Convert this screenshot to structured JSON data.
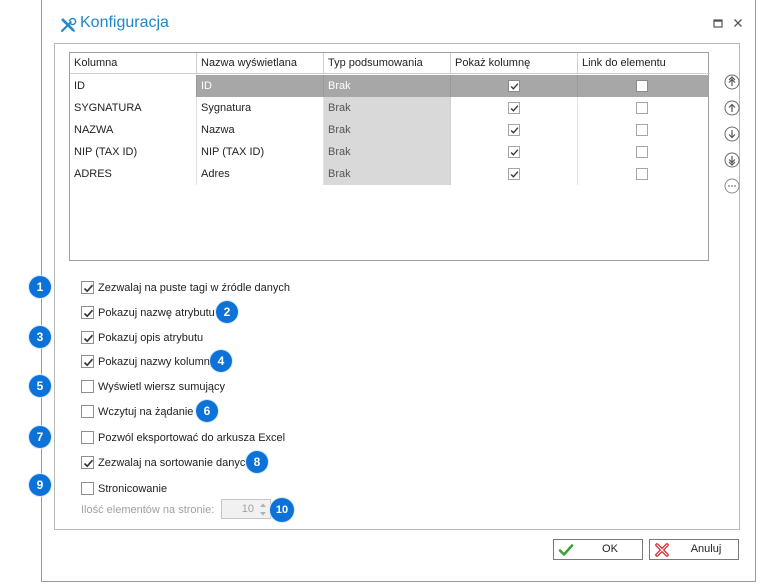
{
  "window": {
    "title": "Konfiguracja"
  },
  "grid": {
    "headers": [
      "Kolumna",
      "Nazwa wyświetlana",
      "Typ podsumowania",
      "Pokaż kolumnę",
      "Link do elementu"
    ],
    "rows": [
      {
        "kolumna": "ID",
        "nazwa": "ID",
        "typ": "Brak",
        "pokaz": true,
        "link": false
      },
      {
        "kolumna": "SYGNATURA",
        "nazwa": "Sygnatura",
        "typ": "Brak",
        "pokaz": true,
        "link": false
      },
      {
        "kolumna": "NAZWA",
        "nazwa": "Nazwa",
        "typ": "Brak",
        "pokaz": true,
        "link": false
      },
      {
        "kolumna": "NIP (TAX ID)",
        "nazwa": "NIP (TAX ID)",
        "typ": "Brak",
        "pokaz": true,
        "link": false
      },
      {
        "kolumna": "ADRES",
        "nazwa": "Adres",
        "typ": "Brak",
        "pokaz": true,
        "link": false
      }
    ]
  },
  "side_buttons": [
    "move-top-icon",
    "move-up-icon",
    "move-down-icon",
    "move-bottom-icon",
    "more-icon"
  ],
  "options": [
    {
      "label": "Zezwalaj na puste tagi w źródle danych",
      "checked": true,
      "badge": "1"
    },
    {
      "label": "Pokazuj nazwę atrybutu",
      "checked": true,
      "badge": "2"
    },
    {
      "label": "Pokazuj opis atrybutu",
      "checked": true,
      "badge": "3"
    },
    {
      "label": "Pokazuj nazwy kolumn",
      "checked": true,
      "badge": "4"
    },
    {
      "label": "Wyświetl wiersz sumujący",
      "checked": false,
      "badge": "5"
    },
    {
      "label": "Wczytuj na żądanie",
      "checked": false,
      "badge": "6"
    },
    {
      "label": "Pozwól eksportować do arkusza Excel",
      "checked": false,
      "badge": "7"
    },
    {
      "label": "Zezwalaj na sortowanie danych",
      "checked": true,
      "badge": "8"
    },
    {
      "label": "Stronicowanie",
      "checked": false,
      "badge": "9"
    }
  ],
  "paging": {
    "label": "Ilość elementów na stronie:",
    "value": "10",
    "badge": "10"
  },
  "buttons": {
    "ok": "OK",
    "cancel": "Anuluj"
  },
  "colors": {
    "accent": "#1f86c9",
    "badge": "#0d72d8",
    "selected_row": "#a7a7a7",
    "ok_icon": "#3aa335",
    "cancel_icon": "#d6262b"
  }
}
